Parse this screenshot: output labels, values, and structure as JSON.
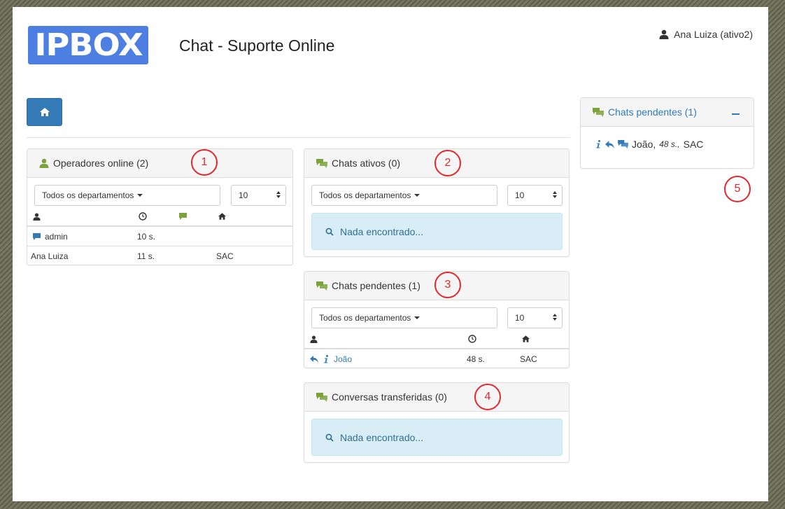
{
  "header": {
    "logo_text": "IPBOX",
    "title": "Chat - Suporte Online",
    "user": "Ana Luiza (ativo2)"
  },
  "operators_panel": {
    "title": "Operadores online (2)",
    "department_filter": "Todos os departamentos",
    "page_size": "10",
    "rows": [
      {
        "name": "admin",
        "time": "10 s.",
        "dept": ""
      },
      {
        "name": "Ana Luiza",
        "time": "11 s.",
        "dept": "SAC"
      }
    ]
  },
  "active_chats_panel": {
    "title": "Chats ativos (0)",
    "department_filter": "Todos os departamentos",
    "page_size": "10",
    "empty_text": "Nada encontrado..."
  },
  "pending_chats_panel": {
    "title": "Chats pendentes (1)",
    "department_filter": "Todos os departamentos",
    "page_size": "10",
    "rows": [
      {
        "name": "João",
        "time": "48 s.",
        "dept": "SAC"
      }
    ]
  },
  "transferred_panel": {
    "title": "Conversas transferidas (0)",
    "empty_text": "Nada encontrado..."
  },
  "side_pending_panel": {
    "title": "Chats pendentes (1)",
    "entry_name": "João,",
    "entry_time": "48 s.,",
    "entry_dept": "SAC"
  },
  "annotations": [
    "1",
    "2",
    "3",
    "4",
    "5"
  ],
  "colors": {
    "primary": "#337ab7",
    "logo_blue": "#4d7fe3",
    "annotation_red": "#e0282e",
    "chat_icon_green": "#7aa33a",
    "alert_bg": "#d9edf7"
  }
}
